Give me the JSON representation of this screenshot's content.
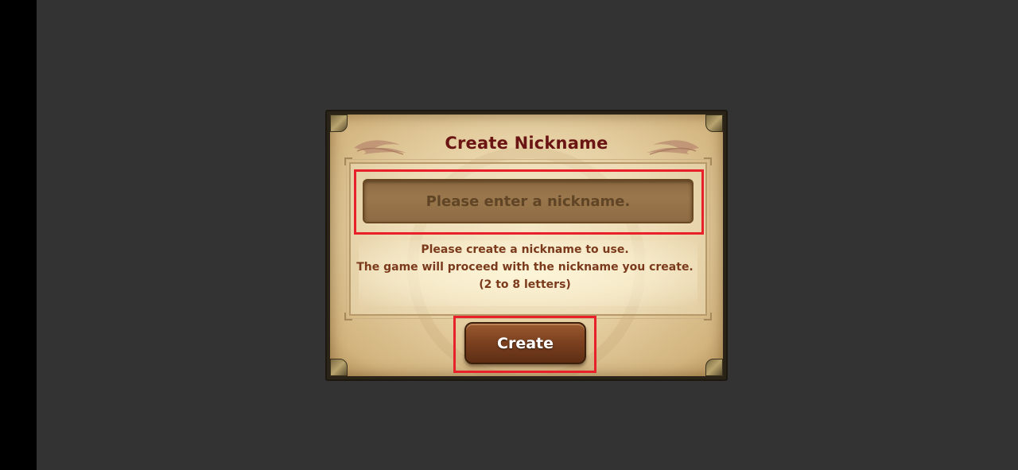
{
  "dialog": {
    "title": "Create Nickname",
    "input": {
      "placeholder": "Please enter a nickname.",
      "value": ""
    },
    "description_lines": [
      "Please create a nickname to use.",
      "The game will proceed with the nickname you create.",
      "(2 to 8 letters)"
    ],
    "create_label": "Create"
  },
  "colors": {
    "background": "#333333",
    "title": "#6a1414",
    "description": "#7b3a1c",
    "highlight": "#e8202a",
    "button": "#7d4220"
  },
  "icons": [
    "wing-ornament-icon",
    "corner-ornament-icon"
  ]
}
